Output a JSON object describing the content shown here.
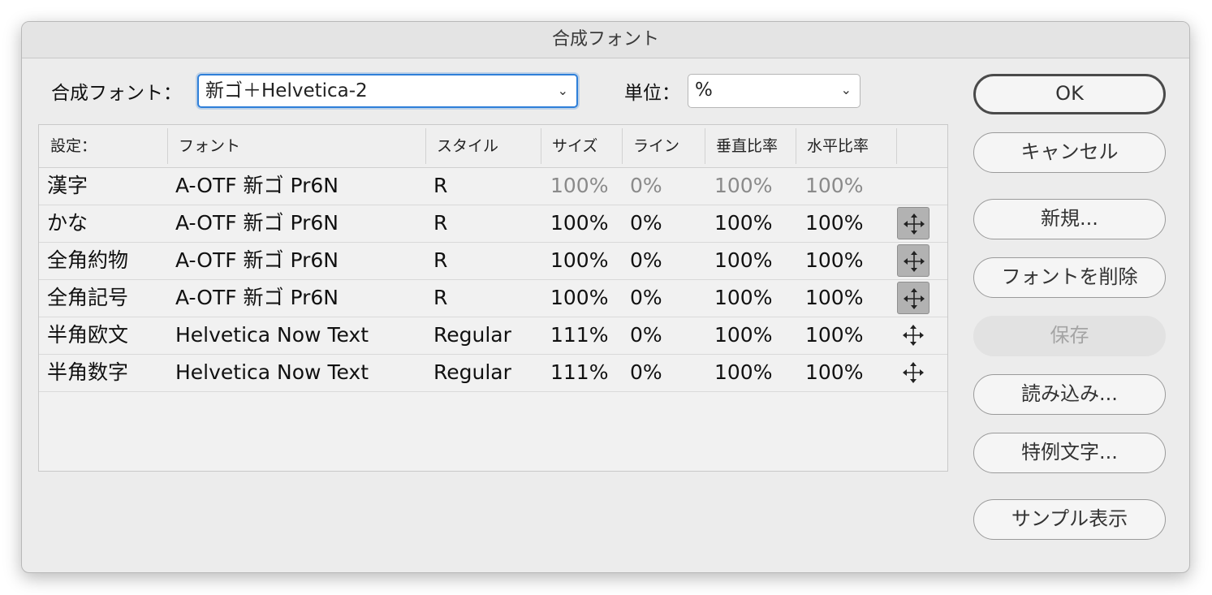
{
  "window": {
    "title": "合成フォント"
  },
  "composite_font": {
    "label": "合成フォント：",
    "value": "新ゴ＋Helvetica-2"
  },
  "unit": {
    "label": "単位：",
    "value": "%"
  },
  "table": {
    "headers": [
      "設定：",
      "フォント",
      "スタイル",
      "サイズ",
      "ライン",
      "垂直比率",
      "水平比率"
    ],
    "rows": [
      {
        "setting": "漢字",
        "font": "A-OTF 新ゴ Pr6N",
        "style": "R",
        "size": "100%",
        "line": "0%",
        "vscale": "100%",
        "hscale": "100%",
        "dim": true,
        "move": "none"
      },
      {
        "setting": "かな",
        "font": "A-OTF 新ゴ Pr6N",
        "style": "R",
        "size": "100%",
        "line": "0%",
        "vscale": "100%",
        "hscale": "100%",
        "dim": false,
        "move": "active"
      },
      {
        "setting": "全角約物",
        "font": "A-OTF 新ゴ Pr6N",
        "style": "R",
        "size": "100%",
        "line": "0%",
        "vscale": "100%",
        "hscale": "100%",
        "dim": false,
        "move": "active"
      },
      {
        "setting": "全角記号",
        "font": "A-OTF 新ゴ Pr6N",
        "style": "R",
        "size": "100%",
        "line": "0%",
        "vscale": "100%",
        "hscale": "100%",
        "dim": false,
        "move": "active"
      },
      {
        "setting": "半角欧文",
        "font": "Helvetica Now Text",
        "style": "Regular",
        "size": "111%",
        "line": "0%",
        "vscale": "100%",
        "hscale": "100%",
        "dim": false,
        "move": "plain"
      },
      {
        "setting": "半角数字",
        "font": "Helvetica Now Text",
        "style": "Regular",
        "size": "111%",
        "line": "0%",
        "vscale": "100%",
        "hscale": "100%",
        "dim": false,
        "move": "plain"
      }
    ]
  },
  "buttons": {
    "ok": "OK",
    "cancel": "キャンセル",
    "new": "新規...",
    "delete_font": "フォントを削除",
    "save": "保存",
    "load": "読み込み...",
    "exceptions": "特例文字...",
    "sample": "サンプル表示"
  },
  "icons": {
    "dropdown": "chevron-down-icon",
    "move": "move-arrows-icon"
  },
  "colors": {
    "focus": "#2e7fd9"
  }
}
